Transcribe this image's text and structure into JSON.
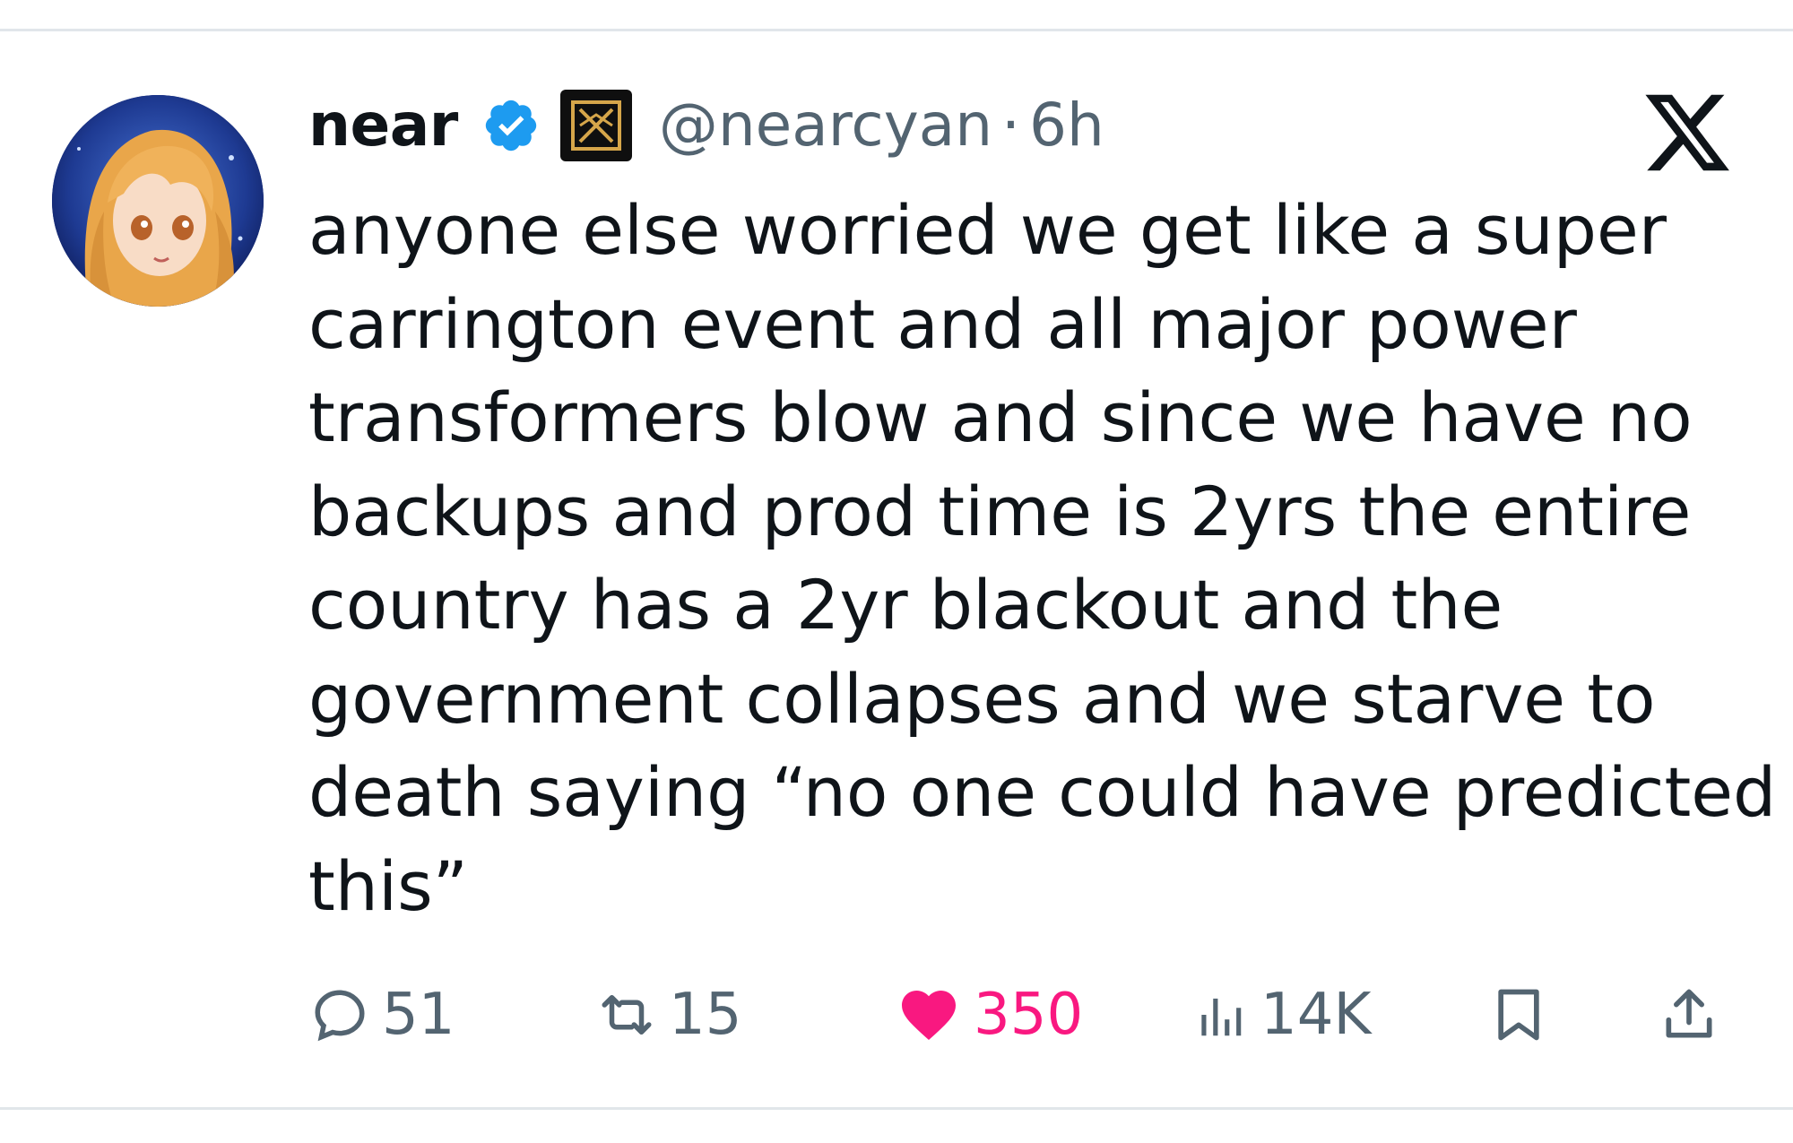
{
  "tweet": {
    "author_name": "near",
    "handle": "@nearcyan",
    "separator": "·",
    "time": "6h",
    "text_lines": [
      "anyone else worried we get like a super",
      "carrington event and all major power",
      "transformers blow and since we have no",
      "backups and prod time is 2yrs the entire",
      "country has a 2yr blackout and the",
      "government collapses and we starve to",
      "death saying “no one could have predicted",
      "this”"
    ]
  },
  "actions": {
    "replies": "51",
    "reposts": "15",
    "likes": "350",
    "views": "14K"
  },
  "colors": {
    "text": "#0f1419",
    "secondary": "#536471",
    "like": "#f91880",
    "verified": "#1d9bf0"
  },
  "icons": {
    "verified": "verified-badge-icon",
    "affiliate": "affiliate-badge-icon",
    "platform": "x-logo-icon",
    "reply": "comment-icon",
    "repost": "repost-icon",
    "like": "heart-icon",
    "views": "views-bar-chart-icon",
    "bookmark": "bookmark-icon",
    "share": "share-icon"
  }
}
